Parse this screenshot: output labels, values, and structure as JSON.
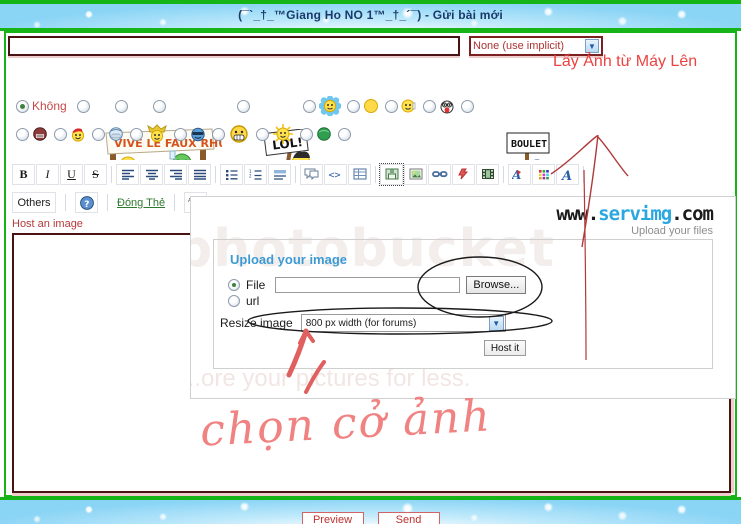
{
  "page": {
    "title": "(¯`_†_™Giang Ho NO 1™_†_´¯) - Gửi bài mới"
  },
  "subject": {
    "value": "",
    "placeholder": ""
  },
  "icon_select": {
    "value": "None (use implicit)",
    "arrow_glyph": "▼"
  },
  "annotations": {
    "upload_label": "Lấy Ảnh từ Máy Lên",
    "handwriting": "chọn cở ảnh"
  },
  "icon_radios": {
    "no_label": "Không",
    "row1_count": 9,
    "row2_count": 10
  },
  "toolbar": {
    "bold": "B",
    "italic": "I",
    "underline": "U",
    "strike": "S",
    "align_left": "≡",
    "align_center": "≡",
    "align_right": "≡",
    "justify": "≡",
    "list_bullet": "☰",
    "list_number": "☰",
    "indent": "☰",
    "quote": "❝",
    "code": "<>",
    "table": "▤",
    "image_host": "🖫",
    "image": "🖼",
    "link": "🔗",
    "flash": "⚡",
    "video": "🎞",
    "font_color": "A",
    "color_palette": "▦",
    "font_size": "A",
    "others_label": "Others",
    "help_glyph": "?",
    "close_tags_label": "Đóng Thẻ",
    "spell_glyph": "A"
  },
  "host_image_caption": "Host an image",
  "servimg": {
    "logo_www": "www.",
    "logo_name": "servimg",
    "logo_tld": ".com",
    "tagline": "Upload your files",
    "watermark": "photobucket",
    "watermark_tagline": "...ore your pictures for less.",
    "heading": "Upload your image",
    "file_label": "File",
    "url_label": "url",
    "file_value": "",
    "browse_label": "Browse...",
    "resize_label": "Resize image",
    "resize_value": "800 px width (for forums)",
    "resize_arrow": "▼",
    "host_it_label": "Host it"
  },
  "bottom": {
    "preview_label": "Preview",
    "send_label": "Send"
  },
  "colors": {
    "green_border": "#17b417",
    "sky_blue": "#8ad4f5",
    "annotation_red": "#ec4242",
    "dark_red_border": "#4a1313",
    "servimg_blue": "#2aa7e0"
  }
}
